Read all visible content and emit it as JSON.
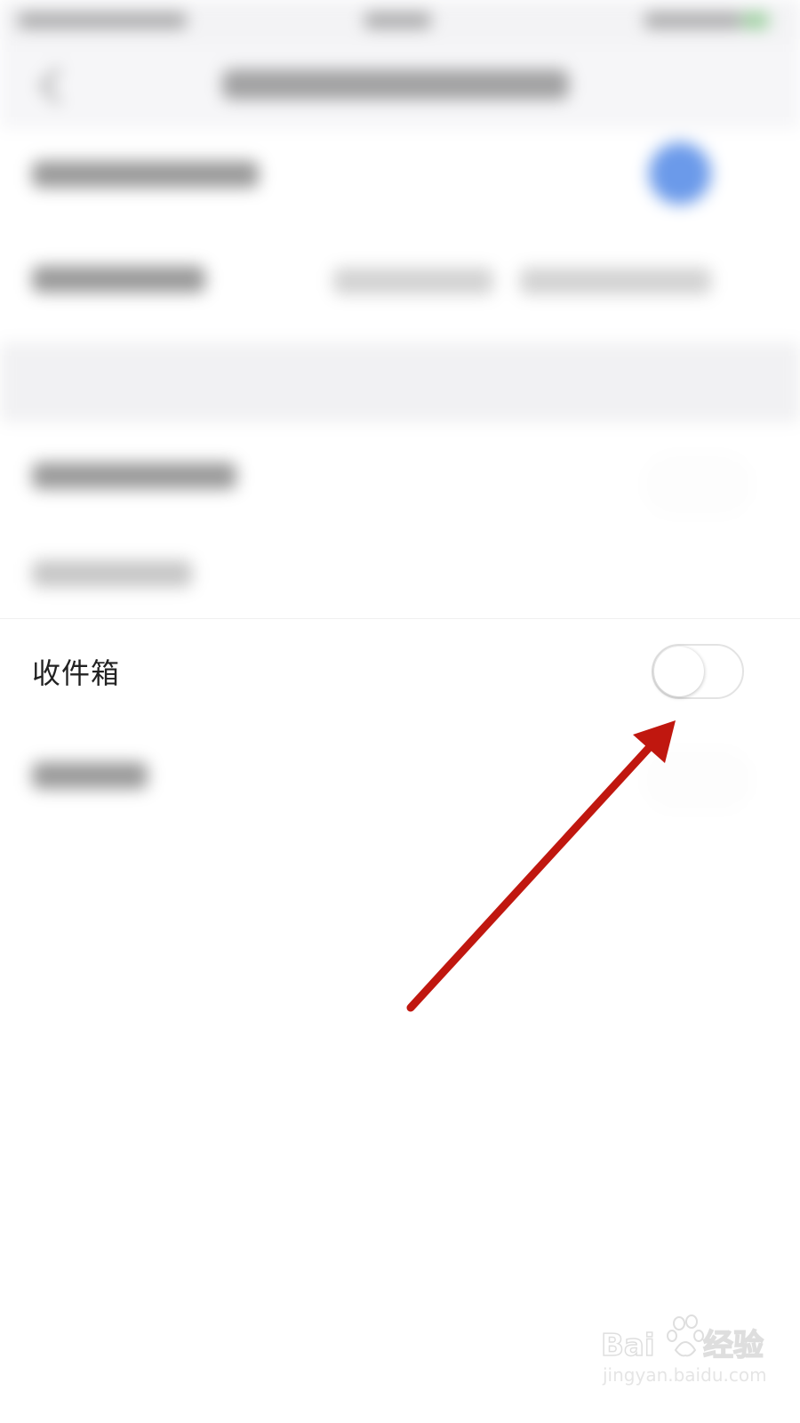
{
  "settings_row": {
    "label": "收件箱",
    "toggle_state": "off"
  },
  "annotation": {
    "type": "arrow",
    "color": "#c0170f",
    "points_to": "inbox-toggle"
  },
  "watermark": {
    "text": "Baidu经验",
    "url_text": "jingyan.baidu.com"
  },
  "colors": {
    "accent_blurred": "#5b8fe8",
    "arrow": "#c0170f"
  }
}
